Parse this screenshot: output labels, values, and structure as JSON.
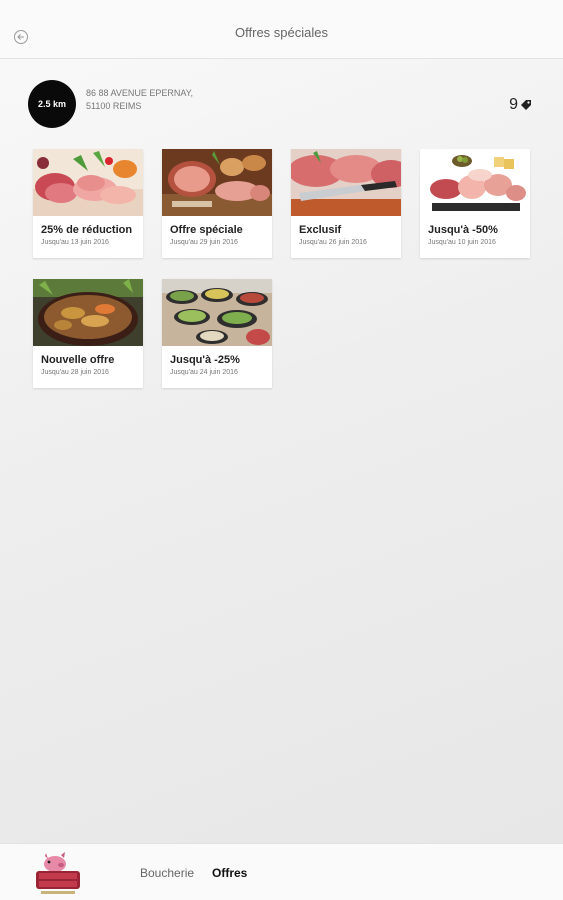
{
  "header": {
    "title": "Offres spéciales",
    "back_icon": "back-arrow-icon"
  },
  "store": {
    "distance": "2.5 km",
    "address_line1": "86 88 AVENUE EPERNAY,",
    "address_line2": "51100 REIMS",
    "offer_count": "9",
    "offer_icon": "tag-icon"
  },
  "offers": [
    {
      "title": "25% de réduction",
      "date": "Jusqu'au 13 juin 2016",
      "image": "charcuterie-platter"
    },
    {
      "title": "Offre spéciale",
      "date": "Jusqu'au 29 juin 2016",
      "image": "roast-ham-bread"
    },
    {
      "title": "Exclusif",
      "date": "Jusqu'au 26 juin 2016",
      "image": "sliced-ham-knife"
    },
    {
      "title": "Jusqu'à -50%",
      "date": "Jusqu'au 10 juin 2016",
      "image": "cold-cuts-board"
    },
    {
      "title": "Nouvelle offre",
      "date": "Jusqu'au 28 juin 2016",
      "image": "stew-bowl"
    },
    {
      "title": "Jusqu'à -25%",
      "date": "Jusqu'au 24 juin 2016",
      "image": "buffet-trays"
    }
  ],
  "bottom_nav": {
    "logo_text": "MAISON RIBIMOT",
    "tabs": [
      {
        "label": "Boucherie",
        "active": false
      },
      {
        "label": "Offres",
        "active": true
      }
    ]
  },
  "colors": {
    "accent": "#111111",
    "badge": "#0a0a0a",
    "background": "#eeeeee"
  }
}
